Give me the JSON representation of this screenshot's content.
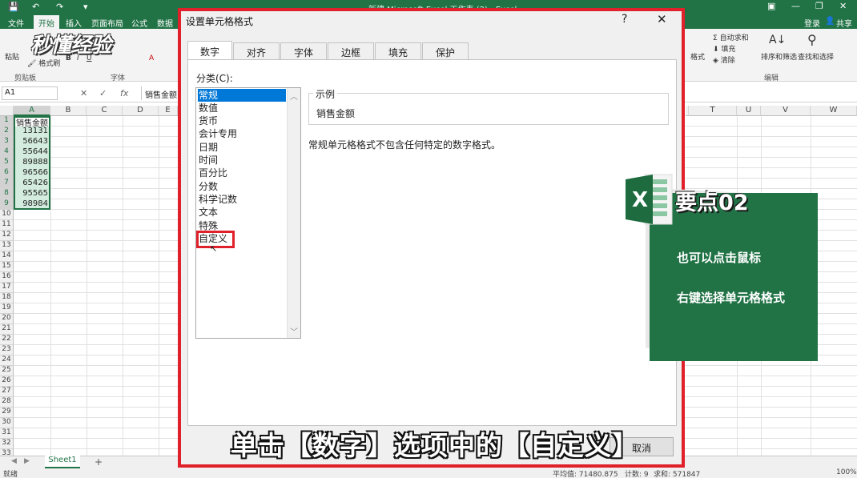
{
  "colors": {
    "excel_green": "#217346",
    "highlight_red": "#e0202a",
    "selection_blue": "#0078d7"
  },
  "titlebar": {
    "title": "新建 Microsoft Excel 工作表 (2) - Excel",
    "icons": [
      "save-icon",
      "undo-icon",
      "redo-icon",
      "customize-icon"
    ]
  },
  "ribbon_tabs": [
    "文件",
    "开始",
    "插入",
    "页面布局",
    "公式",
    "数据"
  ],
  "account": {
    "login": "登录",
    "share": "共享"
  },
  "ribbon": {
    "paste": "粘贴",
    "format_painter": "格式刷",
    "clipboard_group": "剪贴板",
    "font_group": "字体",
    "format": "格式",
    "autosum": "自动求和",
    "fill": "填充",
    "clear": "清除",
    "sort_filter": "排序和筛选",
    "find_select": "查找和选择",
    "edit_group": "编辑"
  },
  "logo_text": "秒懂经验",
  "formula_bar": {
    "name_box": "A1",
    "fx": "fx",
    "value": "销售金额"
  },
  "columns": [
    "A",
    "B",
    "C",
    "D",
    "E"
  ],
  "right_columns": [
    "T",
    "U",
    "V",
    "W"
  ],
  "rows": [
    "1",
    "2",
    "3",
    "4",
    "5",
    "6",
    "7",
    "8",
    "9",
    "10",
    "11",
    "12",
    "13",
    "14",
    "15",
    "16",
    "17",
    "18",
    "19",
    "20",
    "21",
    "22",
    "23",
    "24",
    "25",
    "26",
    "27",
    "28",
    "29",
    "30",
    "31",
    "32",
    "33"
  ],
  "cells": {
    "header": "销售金额",
    "values": [
      "13131",
      "56643",
      "55644",
      "89888",
      "96566",
      "65426",
      "95565",
      "98984"
    ]
  },
  "sheet": {
    "tab": "Sheet1",
    "add": "+"
  },
  "status": {
    "ready": "就绪",
    "average": "平均值: 71480.875",
    "count": "计数: 9",
    "sum": "求和: 571847",
    "zoom": "100%"
  },
  "dialog": {
    "title": "设置单元格格式",
    "help": "?",
    "close": "✕",
    "tabs": [
      "数字",
      "对齐",
      "字体",
      "边框",
      "填充",
      "保护"
    ],
    "category_label": "分类(C):",
    "categories": [
      "常规",
      "数值",
      "货币",
      "会计专用",
      "日期",
      "时间",
      "百分比",
      "分数",
      "科学记数",
      "文本",
      "特殊",
      "自定义"
    ],
    "sample_label": "示例",
    "sample_value": "销售金额",
    "description": "常规单元格格式不包含任何特定的数字格式。",
    "cancel": "取消"
  },
  "caption": "单击【数字】选项中的【自定义】",
  "card": {
    "title": "要点02",
    "line1": "也可以点击鼠标",
    "line2": "右键选择单元格格式"
  }
}
